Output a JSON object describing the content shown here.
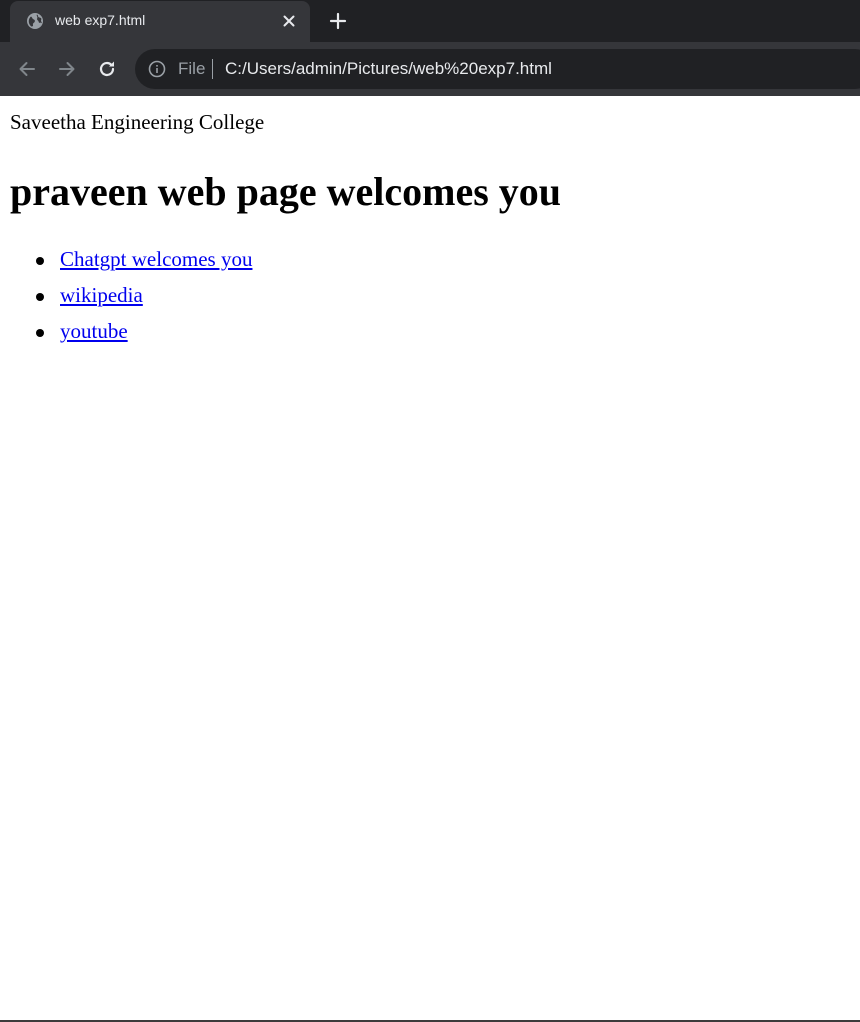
{
  "browser": {
    "tab_title": "web exp7.html",
    "scheme_label": "File",
    "url": "C:/Users/admin/Pictures/web%20exp7.html",
    "icons": {
      "tab": "globe-icon",
      "close": "close-icon",
      "new_tab": "plus-icon",
      "back": "back-arrow-icon",
      "forward": "forward-arrow-icon",
      "reload": "reload-icon",
      "site_info": "info-icon"
    },
    "colors": {
      "frame": "#202124",
      "toolbar": "#35363a",
      "text": "#e8eaed",
      "muted": "#9aa0a6"
    }
  },
  "page": {
    "college": "Saveetha Engineering College",
    "heading": "praveen web page welcomes you",
    "links": [
      {
        "label": "Chatgpt welcomes you"
      },
      {
        "label": "wikipedia"
      },
      {
        "label": "youtube"
      }
    ],
    "colors": {
      "link": "#0000ee",
      "text": "#000000"
    }
  }
}
